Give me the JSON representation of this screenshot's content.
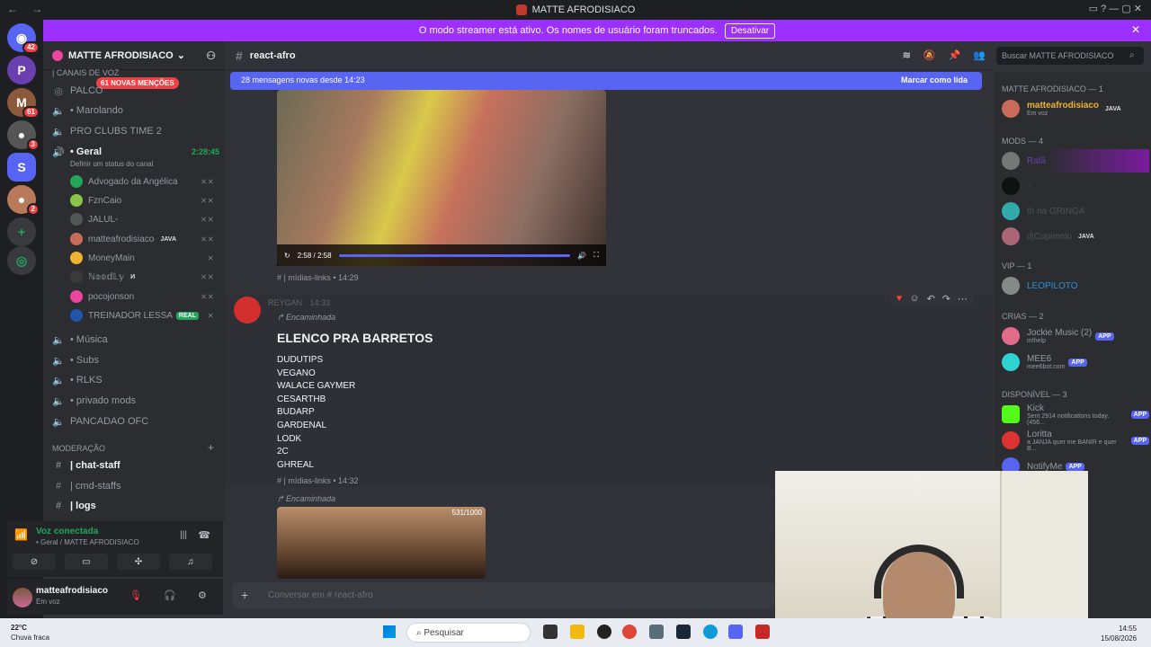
{
  "window": {
    "title": "MATTE AFRODISIACO"
  },
  "banner": {
    "text": "O modo streamer está ativo. Os nomes de usuário foram truncados.",
    "button": "Desativar"
  },
  "server_list": {
    "badges": [
      "42",
      "61",
      "3",
      "2"
    ],
    "s_letter": "S"
  },
  "guild": {
    "name": "MATTE AFRODISIACO"
  },
  "channels": {
    "voice_category": "| Canais de Voz",
    "mentions_pill": "61 NOVAS MENÇÕES",
    "items": [
      {
        "name": "PALCO"
      },
      {
        "name": "• Marolando"
      },
      {
        "name": "PRO CLUBS TIME 2"
      },
      {
        "name": "• Geral",
        "time": "2:28:45",
        "status": "Definir um status do canal"
      }
    ],
    "voice_users": [
      {
        "name": "Advogado da Angélica",
        "color": "#23a55a"
      },
      {
        "name": "FznCaio",
        "color": "#8bc34a"
      },
      {
        "name": "JALUL-",
        "color": "#555"
      },
      {
        "name": "matteafrodisiaco",
        "color": "#c86b5b",
        "tag": "JAVA"
      },
      {
        "name": "MoneyMain",
        "color": "#f0b232"
      },
      {
        "name": "ℕ𝕠𝕠𝕕𝕃𝕪",
        "color": "#3a3a3a",
        "tag": "И"
      },
      {
        "name": "pocojonson",
        "color": "#eb459e"
      },
      {
        "name": "TREINADOR LESSA",
        "color": "#2255aa",
        "tag": "REAL"
      }
    ],
    "more": [
      "• Música",
      "• Subs",
      "• RLKS",
      "• privado mods",
      "PANCADAO OFC"
    ],
    "mod_category": "MODERAÇÃO",
    "mod_channels": [
      "| chat-staff",
      "| cmd-staffs",
      "| logs"
    ]
  },
  "voice": {
    "connected": "Voz conectada",
    "where": "• Geral / MATTE AFRODISIACO"
  },
  "me": {
    "name": "matteafrodisiaco",
    "status": "Em voz"
  },
  "chat": {
    "channel": "react-afro",
    "new_messages": "28 mensagens novas desde 14:23",
    "mark_read": "Marcar como lida",
    "video_time": "2:58 / 2:58",
    "video_meta": "| mídias-links • 14:29",
    "author": "REYGAN",
    "author_time": "14:33",
    "forwarded": "Encaminhada",
    "title": "ELENCO PRA BARRETOS",
    "roster": [
      "DUDUTIPS",
      "VEGANO",
      "WALACE GAYMER",
      "CESARTHB",
      "BUDARP",
      "GARDENAL",
      "LODK",
      "2C",
      "GHREAL"
    ],
    "msg_meta": "| mídias-links • 14:32",
    "forwarded2": "Encaminhada",
    "img_counter": "531/1000",
    "composer_placeholder": "Conversar em # react-afro"
  },
  "search": {
    "placeholder": "Buscar MATTE AFRODISIACO"
  },
  "members": {
    "groups": [
      {
        "label": "MATTE AFRODISIACO — 1",
        "items": [
          {
            "name": "matteafrodisiaco",
            "sub": "Em voz",
            "tag": "JAVA",
            "color": "#c86b5b"
          }
        ]
      },
      {
        "label": "MODS — 4",
        "items": [
          {
            "name": "Rafã",
            "sub": "",
            "color": "#777"
          },
          {
            "name": "x",
            "sub": "",
            "color": "#111"
          },
          {
            "name": "th na GRINGA",
            "sub": "",
            "color": "#3aa"
          },
          {
            "name": "djCupimelo",
            "sub": "",
            "tag": "JAVA",
            "color": "#a67"
          }
        ]
      },
      {
        "label": "VIP — 1",
        "items": [
          {
            "name": "LEOPILOTO",
            "sub": "",
            "color": "#888"
          }
        ]
      },
      {
        "label": "CRIAS — 2",
        "items": [
          {
            "name": "Jockie Music (2)",
            "sub": "m!help",
            "tag": "APP",
            "color": "#e26b8a"
          },
          {
            "name": "MEE6",
            "sub": "mee6bot.com",
            "tag": "APP",
            "color": "#2fd3d3"
          }
        ]
      },
      {
        "label": "Disponível — 3",
        "items": [
          {
            "name": "Kick",
            "sub": "Sent 2914 notifications today. (456...",
            "tag": "APP",
            "color": "#53fc18"
          },
          {
            "name": "Loritta",
            "sub": "a JANJA quer me BANIR e quer B...",
            "tag": "APP",
            "color": "#d33"
          },
          {
            "name": "NotifyMe",
            "sub": "",
            "tag": "APP",
            "color": "#5865f2"
          }
        ]
      }
    ]
  },
  "taskbar": {
    "temp": "22°C",
    "weather": "Chuva fraca",
    "search": "Pesquisar",
    "time": "14:55",
    "date": "15/08/2026"
  }
}
